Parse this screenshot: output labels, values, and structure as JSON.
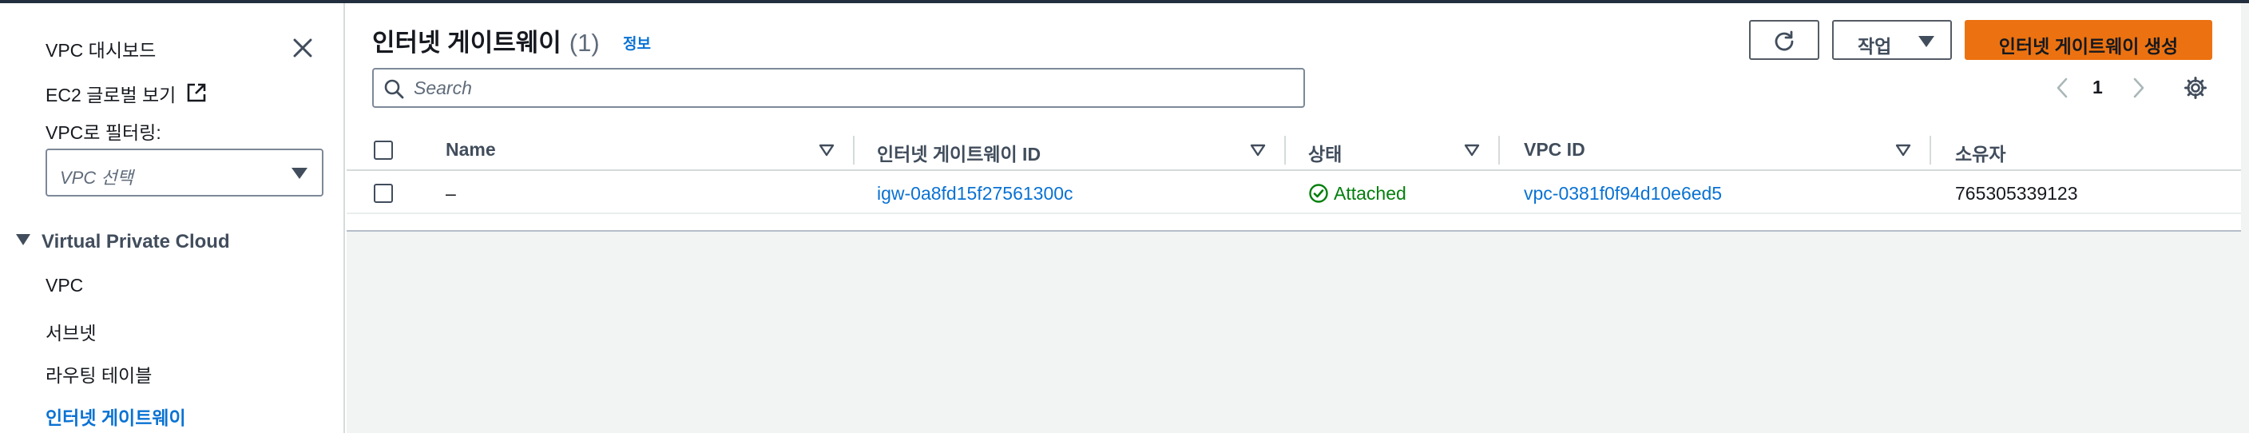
{
  "sidebar": {
    "dashboard_label": "VPC 대시보드",
    "ec2_global_label": "EC2 글로벌 보기",
    "filter_label": "VPC로 필터링:",
    "filter_placeholder": "VPC 선택",
    "section_title": "Virtual Private Cloud",
    "items": [
      {
        "label": "VPC"
      },
      {
        "label": "서브넷"
      },
      {
        "label": "라우팅 테이블"
      },
      {
        "label": "인터넷 게이트웨이"
      }
    ]
  },
  "header": {
    "title": "인터넷 게이트웨이",
    "count": "(1)",
    "info": "정보",
    "actions_label": "작업",
    "create_label": "인터넷 게이트웨이 생성"
  },
  "search": {
    "placeholder": "Search"
  },
  "pagination": {
    "current_page": "1"
  },
  "table": {
    "columns": [
      "Name",
      "인터넷 게이트웨이 ID",
      "상태",
      "VPC ID",
      "소유자"
    ],
    "rows": [
      {
        "name": "–",
        "igw_id": "igw-0a8fd15f27561300c",
        "state": "Attached",
        "vpc_id": "vpc-0381f0f94d10e6ed5",
        "owner": "765305339123"
      }
    ]
  },
  "colors": {
    "link": "#0972d3",
    "primary_button": "#ec7211",
    "status_success": "#037f0c"
  }
}
